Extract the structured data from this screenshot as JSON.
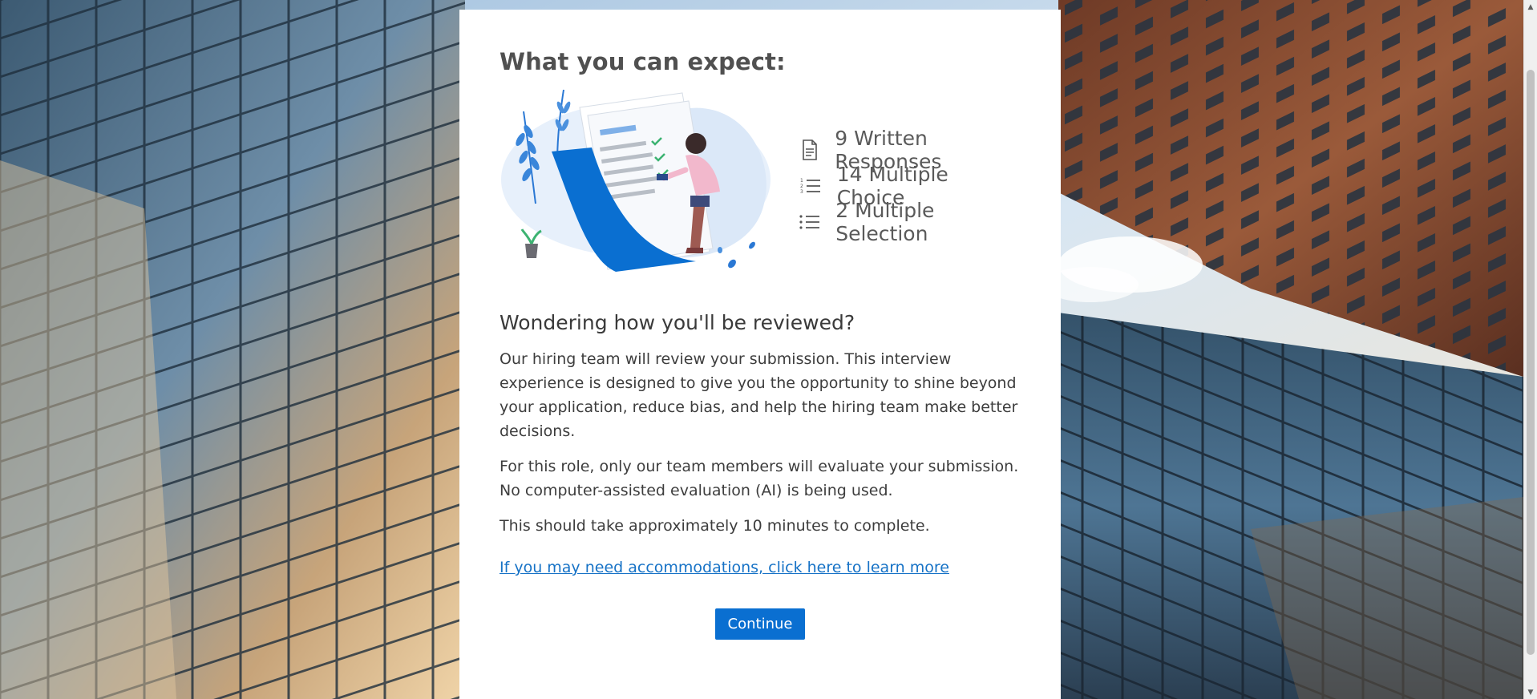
{
  "card": {
    "heading": "What you can expect:",
    "stats": [
      {
        "icon": "document-icon",
        "label": "9 Written Responses"
      },
      {
        "icon": "numbered-list-icon",
        "label": "14 Multiple Choice"
      },
      {
        "icon": "bulleted-list-icon",
        "label": "2 Multiple Selection"
      }
    ],
    "review_heading": "Wondering how you'll be reviewed?",
    "paragraph_1": "Our hiring team will review your submission. This interview experience is designed to give you the opportunity to shine beyond your application, reduce bias, and help the hiring team make better decisions.",
    "paragraph_2": "For this role, only our team members will evaluate your submission. No computer-assisted evaluation (AI) is being used.",
    "paragraph_3": "This should take approximately 10 minutes to complete.",
    "accommodations_link": "If you may need accommodations, click here to learn more",
    "continue_label": "Continue"
  },
  "colors": {
    "accent": "#0a6fd1",
    "link": "#1672c6",
    "card_bg": "#ffffff"
  }
}
